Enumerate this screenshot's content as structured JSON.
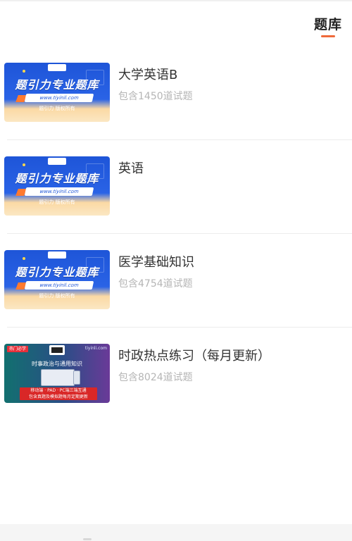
{
  "header": {
    "tab_label": "题库",
    "accent_color": "#ef6a3a"
  },
  "items": [
    {
      "title": "大学英语B",
      "count": "包含1450道试题",
      "thumb": {
        "type": "blue",
        "title": "题引力专业题库",
        "url": "www.tiyinli.com",
        "sub": "题引力 版权所有"
      }
    },
    {
      "title": "英语",
      "count": "",
      "thumb": {
        "type": "blue",
        "title": "题引力专业题库",
        "url": "www.tiyinli.com",
        "sub": "题引力 版权所有"
      }
    },
    {
      "title": "医学基础知识",
      "count": "包含4754道试题",
      "thumb": {
        "type": "blue",
        "title": "题引力专业题库",
        "url": "www.tiyinli.com",
        "sub": "题引力 版权所有"
      }
    },
    {
      "title": "时政热点练习（每月更新）",
      "count": "包含8024道试题",
      "thumb": {
        "type": "purple",
        "tag": "热门必学",
        "site": "tiyinli.com",
        "title": "时事政治与通用知识",
        "bar_line1": "移动端 · PAD · PC端三端互通",
        "bar_line2": "包含真题及模拟题每月定期更新"
      }
    }
  ]
}
